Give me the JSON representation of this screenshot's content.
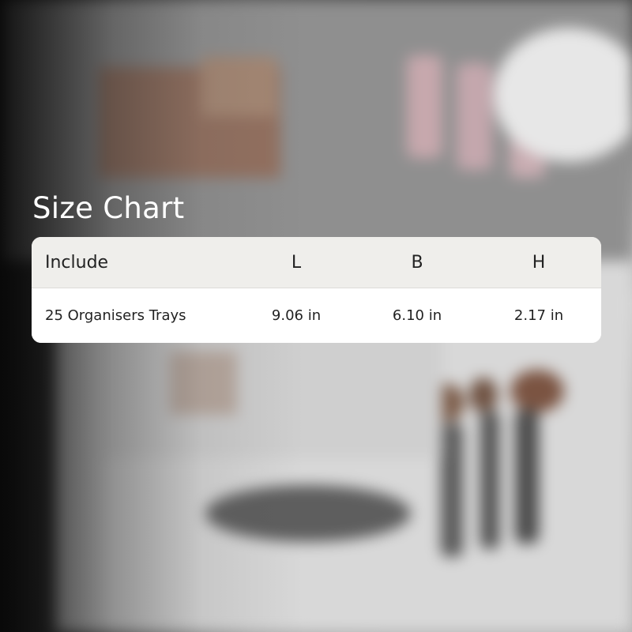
{
  "title": "Size Chart",
  "table": {
    "headers": [
      "Include",
      "L",
      "B",
      "H"
    ],
    "rows": [
      [
        "25 Organisers Trays",
        "9.06 in",
        "6.10 in",
        "2.17 in"
      ]
    ]
  },
  "colors": {
    "title_text": "#ffffff",
    "header_background": "#efeeeb",
    "row_background": "#ffffff",
    "table_text": "#222222"
  }
}
